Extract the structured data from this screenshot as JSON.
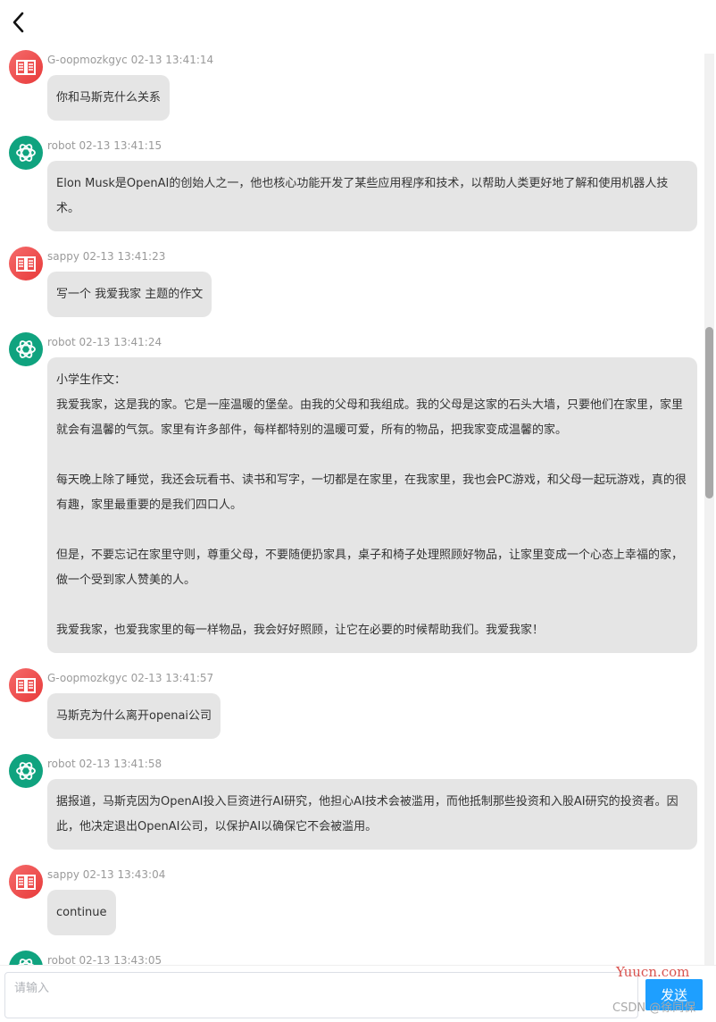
{
  "input": {
    "placeholder": "请输入",
    "value": ""
  },
  "send_label": "发送",
  "watermarks": {
    "site": "Yuucn.com",
    "csdn": "CSDN @徐同保"
  },
  "colors": {
    "user_avatar": "#ef4444",
    "robot_avatar": "#10a37f",
    "bubble": "#e5e5e5",
    "send_button": "#1e9fff"
  },
  "messages": [
    {
      "sender": "G-oopmozkgyc",
      "time": "02-13 13:41:14",
      "role": "user",
      "avatar_icon": "book-icon",
      "paragraphs": [
        "你和马斯克什么关系"
      ]
    },
    {
      "sender": "robot",
      "time": "02-13 13:41:15",
      "role": "robot",
      "avatar_icon": "openai-icon",
      "paragraphs": [
        "Elon Musk是OpenAI的创始人之一，他也核心功能开发了某些应用程序和技术，以帮助人类更好地了解和使用机器人技术。"
      ]
    },
    {
      "sender": "sappy",
      "time": "02-13 13:41:23",
      "role": "user",
      "avatar_icon": "book-icon",
      "paragraphs": [
        "写一个 我爱我家 主题的作文"
      ]
    },
    {
      "sender": "robot",
      "time": "02-13 13:41:24",
      "role": "robot",
      "avatar_icon": "openai-icon",
      "paragraphs": [
        "小学生作文：",
        "我爱我家，这是我的家。它是一座温暖的堡垒。由我的父母和我组成。我的父母是这家的石头大墙，只要他们在家里，家里就会有温馨的气氛。家里有许多部件，每样都特别的温暖可爱，所有的物品，把我家变成温馨的家。",
        "",
        "每天晚上除了睡觉，我还会玩看书、读书和写字，一切都是在家里，在我家里，我也会PC游戏，和父母一起玩游戏，真的很有趣，家里最重要的是我们四口人。",
        "",
        "但是，不要忘记在家里守则，尊重父母，不要随便扔家具，桌子和椅子处理照顾好物品，让家里变成一个心态上幸福的家，做一个受到家人赞美的人。",
        "",
        "我爱我家，也爱我家里的每一样物品，我会好好照顾，让它在必要的时候帮助我们。我爱我家！"
      ]
    },
    {
      "sender": "G-oopmozkgyc",
      "time": "02-13 13:41:57",
      "role": "user",
      "avatar_icon": "book-icon",
      "paragraphs": [
        "马斯克为什么离开openai公司"
      ]
    },
    {
      "sender": "robot",
      "time": "02-13 13:41:58",
      "role": "robot",
      "avatar_icon": "openai-icon",
      "paragraphs": [
        "据报道，马斯克因为OpenAI投入巨资进行AI研究，他担心AI技术会被滥用，而他抵制那些投资和入股AI研究的投资者。因此，他决定退出OpenAI公司，以保护AI以确保它不会被滥用。"
      ]
    },
    {
      "sender": "sappy",
      "time": "02-13 13:43:04",
      "role": "user",
      "avatar_icon": "book-icon",
      "paragraphs": [
        "continue"
      ]
    },
    {
      "sender": "robot",
      "time": "02-13 13:43:05",
      "role": "robot",
      "avatar_icon": "openai-icon",
      "paragraphs": []
    }
  ]
}
